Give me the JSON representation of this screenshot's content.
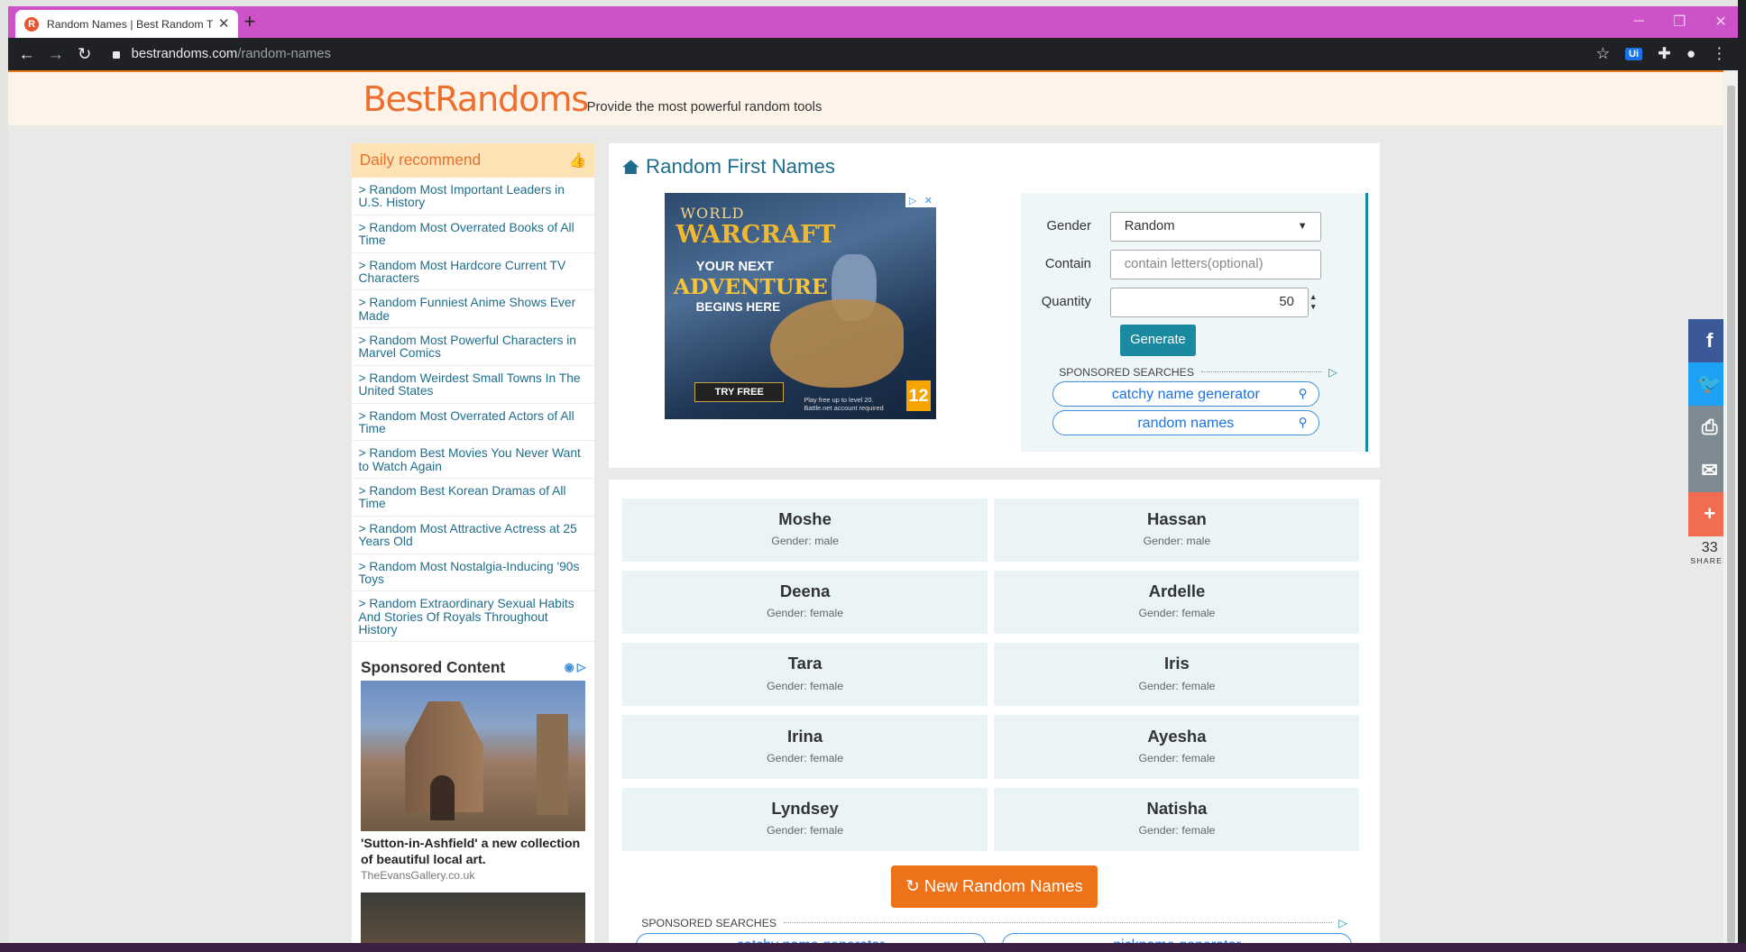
{
  "browser": {
    "tab_title": "Random Names | Best Random T",
    "tab_favicon": "R",
    "new_tab": "+",
    "url_domain": "bestrandoms.com",
    "url_path": "/random-names",
    "ext_label": "Ui"
  },
  "site": {
    "logo": "BestRandoms",
    "tagline": "Provide the most powerful random tools"
  },
  "sidebar": {
    "title": "Daily recommend",
    "items": [
      "> Random Most Important Leaders in U.S. History",
      "> Random Most Overrated Books of All Time",
      "> Random Most Hardcore Current TV Characters",
      "> Random Funniest Anime Shows Ever Made",
      "> Random Most Powerful Characters in Marvel Comics",
      "> Random Weirdest Small Towns In The United States",
      "> Random Most Overrated Actors of All Time",
      "> Random Best Movies You Never Want to Watch Again",
      "> Random Best Korean Dramas of All Time",
      "> Random Most Attractive Actress at 25 Years Old",
      "> Random Most Nostalgia-Inducing '90s Toys",
      "> Random Extraordinary Sexual Habits And Stories Of Royals Throughout History"
    ],
    "sponsored_title": "Sponsored Content",
    "sponsored_caption": "'Sutton-in-Ashfield' a new collection of beautiful local art.",
    "sponsored_source": "TheEvansGallery.co.uk"
  },
  "main": {
    "title": "Random First Names",
    "ad": {
      "line1": "WORLD",
      "line2": "WARCRAFT",
      "line3": "YOUR NEXT",
      "line4": "ADVENTURE",
      "line5": "BEGINS HERE",
      "cta": "TRY FREE",
      "fine": "Play free up to level 20. Battle.net account required",
      "rating": "12"
    },
    "form": {
      "gender_label": "Gender",
      "gender_value": "Random",
      "contain_label": "Contain",
      "contain_placeholder": "contain letters(optional)",
      "quantity_label": "Quantity",
      "quantity_value": "50",
      "generate": "Generate",
      "sponsored_searches": "SPONSORED SEARCHES",
      "search1": "catchy name generator",
      "search2": "random names"
    },
    "names": [
      {
        "name": "Moshe",
        "gender": "Gender: male"
      },
      {
        "name": "Hassan",
        "gender": "Gender: male"
      },
      {
        "name": "Deena",
        "gender": "Gender: female"
      },
      {
        "name": "Ardelle",
        "gender": "Gender: female"
      },
      {
        "name": "Tara",
        "gender": "Gender: female"
      },
      {
        "name": "Iris",
        "gender": "Gender: female"
      },
      {
        "name": "Irina",
        "gender": "Gender: female"
      },
      {
        "name": "Ayesha",
        "gender": "Gender: female"
      },
      {
        "name": "Lyndsey",
        "gender": "Gender: female"
      },
      {
        "name": "Natisha",
        "gender": "Gender: female"
      }
    ],
    "new_button": "↻ New Random Names",
    "sponsored_searches2": "SPONSORED SEARCHES",
    "search3": "catchy name generator",
    "search4": "nickname generator"
  },
  "share": {
    "count": "33",
    "label": "SHARES",
    "colors": [
      "#3b5998",
      "#1da1f2",
      "#7d8a91",
      "#7d8a91",
      "#f26c4f"
    ]
  }
}
